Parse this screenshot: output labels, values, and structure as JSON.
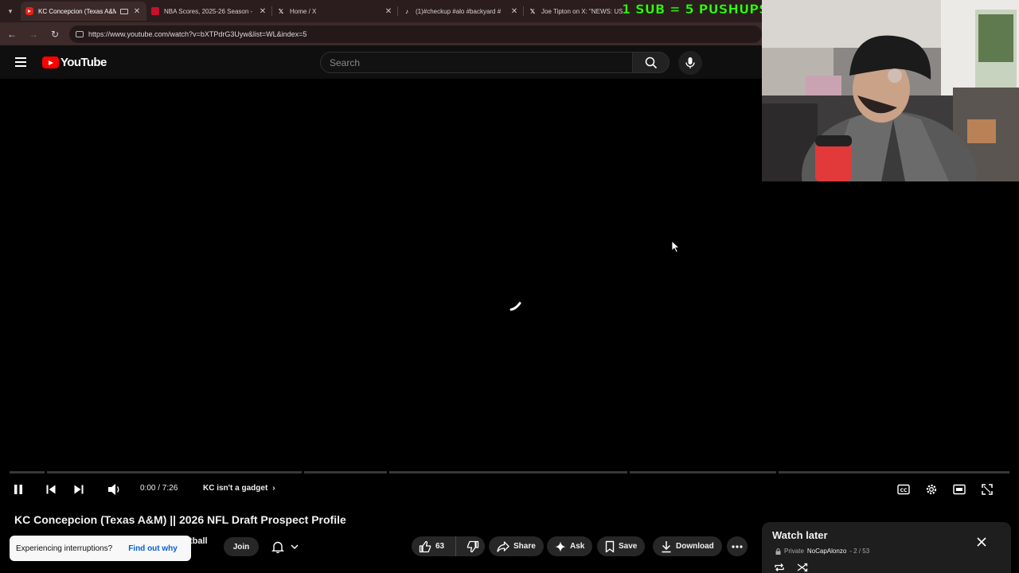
{
  "browser": {
    "tabs": [
      {
        "title": "KC Concepcion (Texas A&M)",
        "icon": "youtube-favicon",
        "active": true
      },
      {
        "title": "NBA Scores, 2025-26 Season -",
        "icon": "nba-favicon",
        "active": false
      },
      {
        "title": "Home / X",
        "icon": "x-favicon",
        "active": false
      },
      {
        "title": "(1)#checkup #alo #backyard #",
        "icon": "tiktok-favicon",
        "active": false
      },
      {
        "title": "Joe Tipton on X: \"NEWS: US",
        "icon": "x-favicon",
        "active": false
      }
    ],
    "url": "https://www.youtube.com/watch?v=bXTPdrG3Uyw&list=WL&index=5"
  },
  "stream_overlay": {
    "text": "1 SUB = 5 PUSHUPS",
    "color": "#39ff14"
  },
  "youtube": {
    "logo_text": "YouTube",
    "search_placeholder": "Search",
    "accent": "#ff0000"
  },
  "player": {
    "time": "0:00 / 7:26",
    "chapter": "KC isn't a gadget",
    "state": "loading",
    "progress_fraction": 0
  },
  "video": {
    "title": "KC Concepcion (Texas A&M) || 2026 NFL Draft Prospect Profile",
    "channel_tail": "tball",
    "join_label": "Join",
    "like_count": "63",
    "share_label": "Share",
    "ask_label": "Ask",
    "save_label": "Save",
    "download_label": "Download"
  },
  "toast": {
    "message": "Experiencing interruptions?",
    "link": "Find out why"
  },
  "watch_later": {
    "title": "Watch later",
    "privacy": "Private",
    "owner": "NoCapAlonzo",
    "position": "- 2 / 53"
  }
}
